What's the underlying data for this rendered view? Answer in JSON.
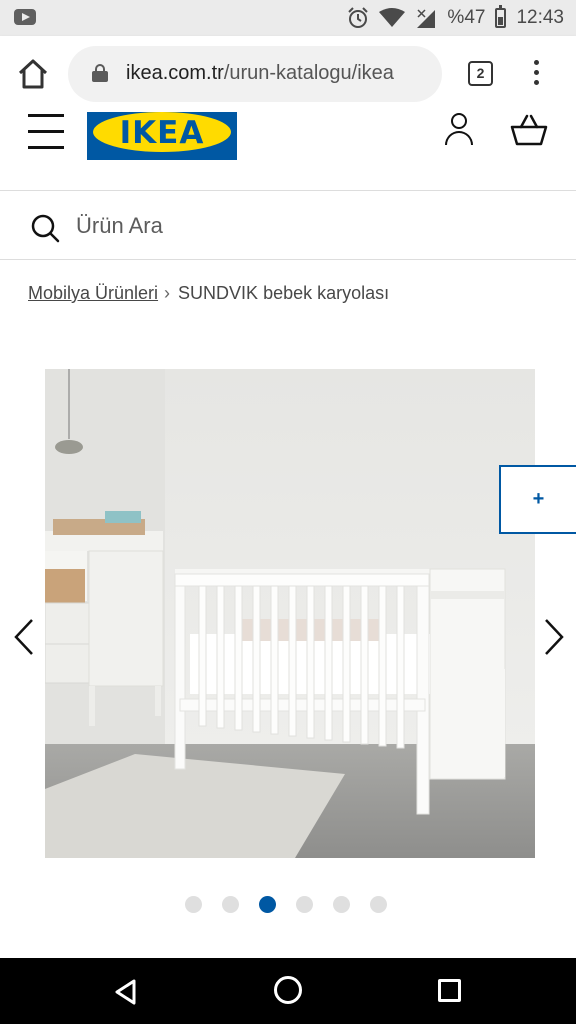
{
  "status_bar": {
    "battery": "%47",
    "time": "12:43",
    "icons": [
      "youtube-icon",
      "alarm-icon",
      "wifi-icon",
      "signal-icon",
      "battery-icon"
    ]
  },
  "browser": {
    "url_host": "ikea.com.tr",
    "url_path": "/urun-katalogu/ikea",
    "tab_count": "2"
  },
  "header": {
    "logo_text": "IKEA",
    "brand_colors": {
      "blue": "#0058a3",
      "yellow": "#ffdb00"
    }
  },
  "search": {
    "placeholder": "Ürün Ara"
  },
  "breadcrumb": {
    "parent": "Mobilya Ürünleri",
    "current": "SUNDVIK bebek karyolası"
  },
  "gallery": {
    "zoom_label": "+",
    "image_count": 6,
    "active_index": 2
  }
}
